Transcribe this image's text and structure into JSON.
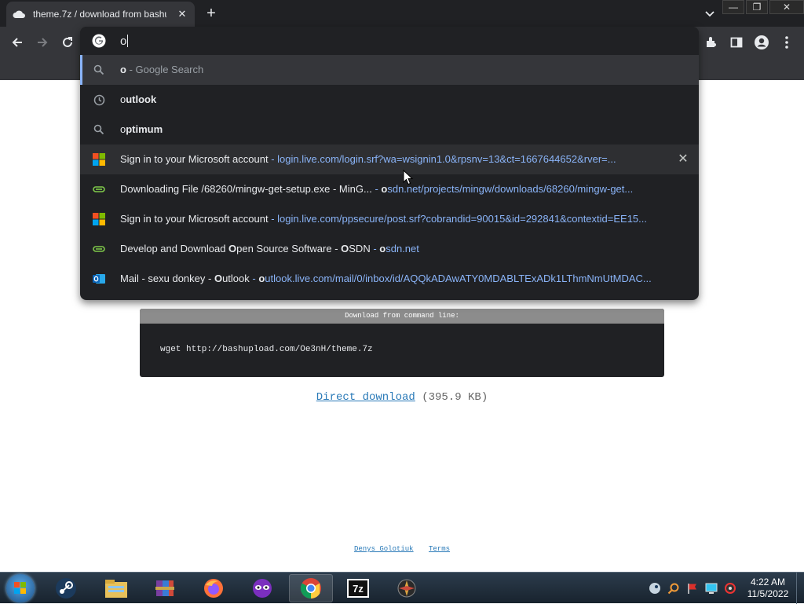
{
  "browser": {
    "tab_title": "theme.7z / download from bashu",
    "tab_close_icon": "close-icon",
    "new_tab_icon": "plus-icon",
    "window_controls": {
      "minimize": "—",
      "maximize": "❐",
      "close": "✕"
    }
  },
  "omnibox": {
    "input_value": "o",
    "suggestions": [
      {
        "kind": "search",
        "icon": "search-icon",
        "bold_prefix": "o",
        "rest": "",
        "muted": " - Google Search",
        "url_bold": "",
        "url": "",
        "selected": true
      },
      {
        "kind": "history",
        "icon": "clock-icon",
        "bold_prefix": "",
        "typed": "o",
        "rest": "utlook",
        "muted": "",
        "url_bold": "",
        "url": ""
      },
      {
        "kind": "search",
        "icon": "search-icon",
        "bold_prefix": "",
        "typed": "o",
        "rest": "ptimum",
        "muted": "",
        "url_bold": "",
        "url": ""
      },
      {
        "kind": "page",
        "icon": "microsoft-icon",
        "title": "Sign in to your Microsoft account",
        "sep": " - ",
        "url_bold": "",
        "url": "login.live.com/login.srf?wa=wsignin1.0&rpsnv=13&ct=1667644652&rver=...",
        "removable": true
      },
      {
        "kind": "page",
        "icon": "osdn-icon",
        "title": "Downloading File /68260/mingw-get-setup.exe - MinG...",
        "sep": "  - ",
        "url_bold": "o",
        "url": "sdn.net/projects/mingw/downloads/68260/mingw-get..."
      },
      {
        "kind": "page",
        "icon": "microsoft-icon",
        "title": "Sign in to your Microsoft account",
        "sep": " - ",
        "url_bold": "",
        "url": "login.live.com/ppsecure/post.srf?cobrandid=90015&id=292841&contextid=EE15..."
      },
      {
        "kind": "page",
        "icon": "osdn-icon",
        "title_pre": "Develop and Download ",
        "title_b1": "O",
        "title_mid": "pen Source Software - ",
        "title_b2": "O",
        "title_post": "SDN",
        "sep": " - ",
        "url_bold": "o",
        "url": "sdn.net"
      },
      {
        "kind": "page",
        "icon": "outlook-icon",
        "title_pre": "Mail - sexu donkey - ",
        "title_b1": "O",
        "title_mid": "utlook",
        "sep": " - ",
        "url_bold": "o",
        "url": "utlook.live.com/mail/0/inbox/id/AQQkADAwATY0MDABLTExADk1LThmNmUtMDAC..."
      }
    ]
  },
  "page": {
    "cmd_header": "Download from command line:",
    "cmd_text": "wget http://bashupload.com/Oe3nH/theme.7z",
    "direct_download": "Direct download",
    "size": "(395.9 KB)",
    "footer_author": "Denys Golotiuk",
    "footer_terms": "Terms"
  },
  "taskbar": {
    "apps": [
      "steam-icon",
      "file-explorer-icon",
      "winrar-icon",
      "firefox-icon",
      "mask-app-icon",
      "chrome-icon",
      "7zip-icon",
      "app-icon"
    ],
    "time": "4:22 AM",
    "date": "11/5/2022"
  },
  "colors": {
    "chrome_dark": "#202124",
    "chrome_toolbar": "#35363a",
    "link_blue": "#8ab4f8",
    "page_link": "#2a7ab8"
  }
}
